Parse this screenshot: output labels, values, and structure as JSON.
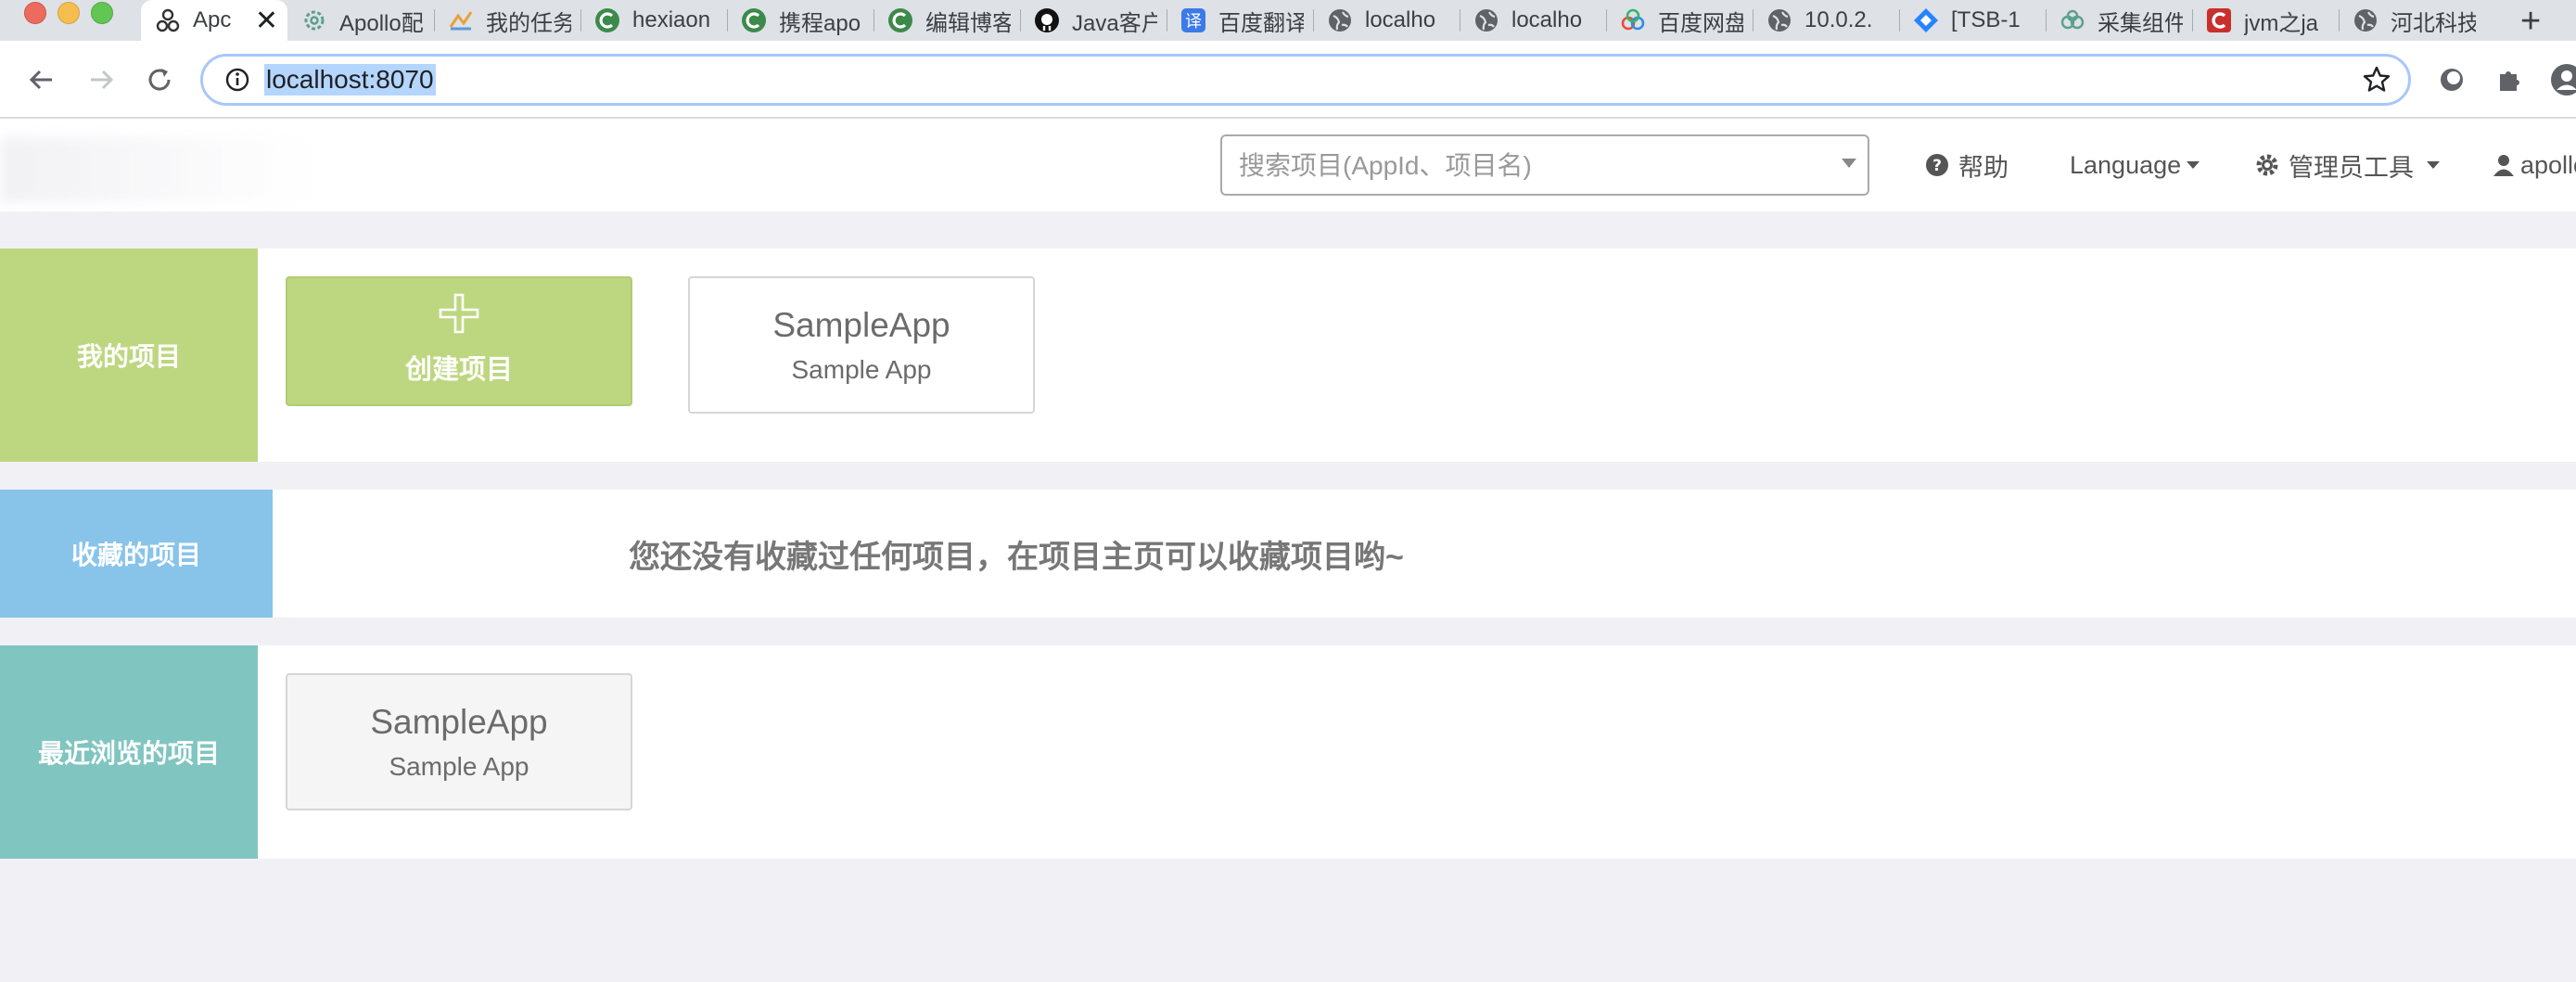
{
  "browser": {
    "tabs": [
      {
        "title": "Apc",
        "icon": "apollo-icon",
        "active": true
      },
      {
        "title": "Apollo配",
        "icon": "gear-icon"
      },
      {
        "title": "我的任务",
        "icon": "task-icon"
      },
      {
        "title": "hexiaon",
        "icon": "c-logo-icon"
      },
      {
        "title": "携程apo",
        "icon": "c-logo-icon"
      },
      {
        "title": "编辑博客",
        "icon": "c-logo-icon"
      },
      {
        "title": "Java客户",
        "icon": "github-icon"
      },
      {
        "title": "百度翻译",
        "icon": "translate-icon"
      },
      {
        "title": "localho",
        "icon": "globe-icon"
      },
      {
        "title": "localho",
        "icon": "globe-icon"
      },
      {
        "title": "百度网盘",
        "icon": "baidu-cloud-icon"
      },
      {
        "title": "10.0.2.",
        "icon": "globe-icon"
      },
      {
        "title": "[TSB-1",
        "icon": "jira-icon"
      },
      {
        "title": "采集组件",
        "icon": "cloud-icon"
      },
      {
        "title": "jvm之ja",
        "icon": "csdn-icon"
      },
      {
        "title": "河北科技",
        "icon": "globe-icon"
      }
    ],
    "new_tab": "+",
    "url": "localhost:8070"
  },
  "header": {
    "search_placeholder": "搜索项目(AppId、项目名)",
    "help": "帮助",
    "language": "Language",
    "admin_tools": "管理员工具",
    "user": "apollo"
  },
  "sections": {
    "mine": {
      "label": "我的项目",
      "create_label": "创建项目",
      "apps": [
        {
          "app_id": "SampleApp",
          "name": "Sample App"
        }
      ]
    },
    "favorites": {
      "label": "收藏的项目",
      "empty_text": "您还没有收藏过任何项目，在项目主页可以收藏项目哟~"
    },
    "recent": {
      "label": "最近浏览的项目",
      "apps": [
        {
          "app_id": "SampleApp",
          "name": "Sample App"
        }
      ]
    }
  },
  "colors": {
    "mine_accent": "#bdd780",
    "favorites_accent": "#88c4ea",
    "recent_accent": "#80c5c0",
    "page_background": "#f1f1f5"
  }
}
